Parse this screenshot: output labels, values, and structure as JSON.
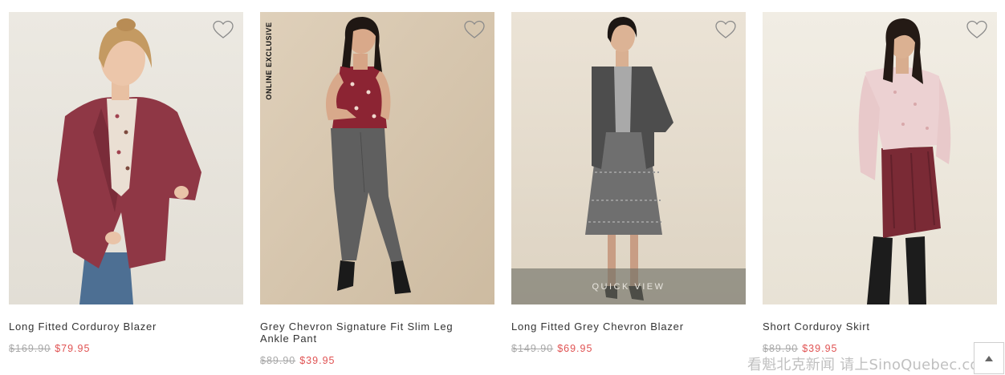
{
  "products": [
    {
      "title": "Long Fitted Corduroy Blazer",
      "old_price": "$169.90",
      "new_price": "$79.95",
      "wishlist_icon": "heart-outline-icon"
    },
    {
      "title": "Grey Chevron Signature Fit Slim Leg Ankle Pant",
      "old_price": "$89.90",
      "new_price": "$39.95",
      "badge": "ONLINE EXCLUSIVE",
      "wishlist_icon": "heart-outline-icon"
    },
    {
      "title": "Long Fitted Grey Chevron Blazer",
      "old_price": "$149.90",
      "new_price": "$69.95",
      "quick_view": "QUICK VIEW",
      "wishlist_icon": "heart-outline-icon"
    },
    {
      "title": "Short Corduroy Skirt",
      "old_price": "$89.90",
      "new_price": "$39.95",
      "wishlist_icon": "heart-outline-icon"
    }
  ],
  "back_to_top_icon": "arrow-up-icon",
  "watermark": "看魁北克新闻 请上SinoQuebec.com",
  "colors": {
    "sale_price": "#e05252",
    "old_price": "#a8a8a8",
    "title_text": "#333333"
  }
}
